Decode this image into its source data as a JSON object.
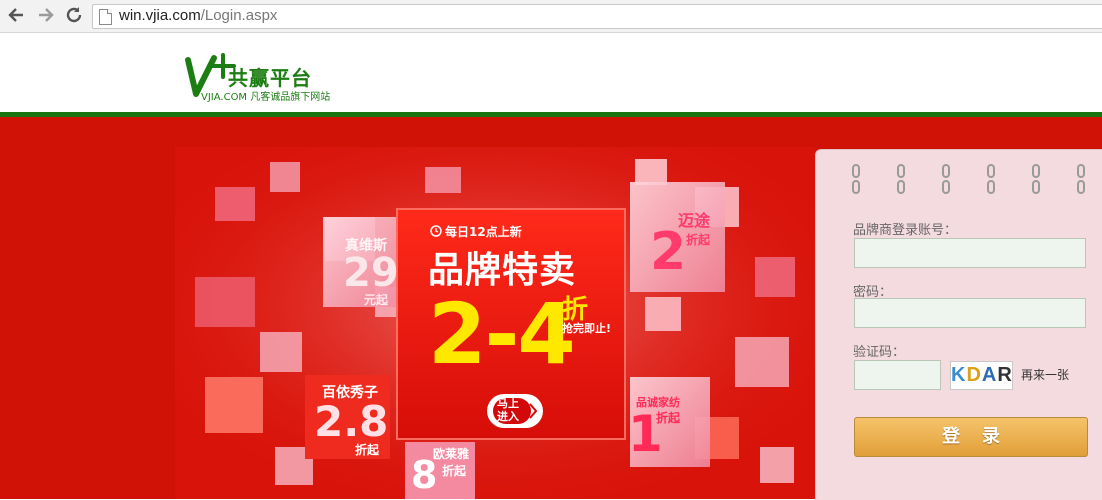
{
  "browser": {
    "back_icon": "arrow-left-icon",
    "forward_icon": "arrow-right-icon",
    "reload_icon": "reload-icon",
    "url_host": "win.vjia.com",
    "url_path": "/Login.aspx"
  },
  "header": {
    "logo_mark": "V+",
    "logo_title": "共赢平台",
    "logo_subtitle": "VJIA.COM 凡客诚品旗下网站",
    "brand_color": "#1c7d12"
  },
  "banner": {
    "tag": "每日12点上新",
    "headline": "品牌特卖",
    "discount": "2-4",
    "discount_unit": "折",
    "discount_note": "抢完即止!",
    "enter_line1": "马上",
    "enter_line2": "进入",
    "tiles": [
      {
        "brand": "真维斯",
        "number": "29",
        "suffix": "元起"
      },
      {
        "brand": "迈途",
        "number": "2",
        "suffix": "折起"
      },
      {
        "brand": "百依秀子",
        "number": "2.8",
        "suffix": "折起"
      },
      {
        "brand": "品诚家纺",
        "number": "1",
        "suffix": "折起"
      },
      {
        "brand": "欧莱雅",
        "number": "8",
        "suffix": "折起"
      }
    ]
  },
  "login": {
    "account_label": "品牌商登录账号：",
    "password_label": "密码：",
    "captcha_label": "验证码：",
    "captcha_chars": [
      "K",
      "D",
      "A",
      "R"
    ],
    "refresh_label": "再来一张",
    "submit_label": "登录",
    "account_value": "",
    "password_value": "",
    "captcha_value": ""
  }
}
